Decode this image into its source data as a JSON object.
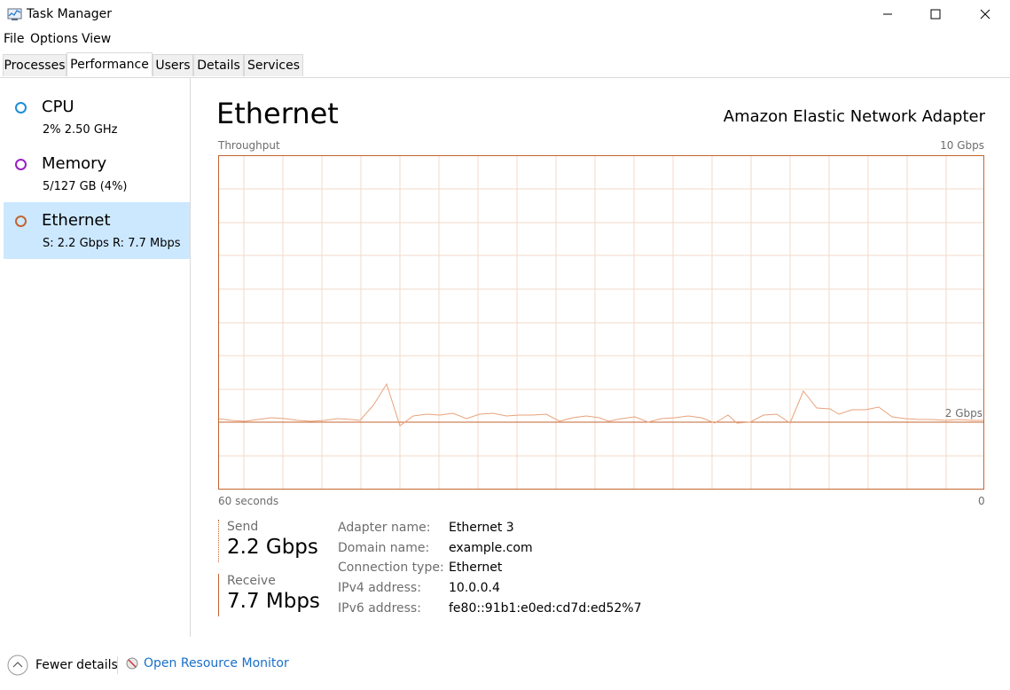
{
  "window": {
    "title": "Task Manager"
  },
  "menu": [
    "File",
    "Options",
    "View"
  ],
  "tabs": [
    "Processes",
    "Performance",
    "Users",
    "Details",
    "Services"
  ],
  "sidebar": {
    "items": [
      {
        "title": "CPU",
        "sub": "2%  2.50 GHz",
        "color": "#1f8dd6"
      },
      {
        "title": "Memory",
        "sub": "5/127 GB (4%)",
        "color": "#9b1fc1"
      },
      {
        "title": "Ethernet",
        "sub": "S: 2.2 Gbps  R: 7.7 Mbps",
        "color": "#c3652f"
      }
    ]
  },
  "main": {
    "title": "Ethernet",
    "adapter": "Amazon Elastic Network Adapter",
    "graph": {
      "label": "Throughput",
      "max_label": "10 Gbps",
      "scale_label": "2 Gbps",
      "time_label": "60 seconds",
      "zero_label": "0",
      "line_color": "#e8a27c",
      "grid_color": "#f3d9ca",
      "border_color": "#c3652f"
    },
    "send": {
      "label": "Send",
      "value": "2.2 Gbps"
    },
    "receive": {
      "label": "Receive",
      "value": "7.7 Mbps"
    },
    "properties": [
      {
        "key": "Adapter name:",
        "value": "Ethernet 3"
      },
      {
        "key": "Domain name:",
        "value": "example.com"
      },
      {
        "key": "Connection type:",
        "value": "Ethernet"
      },
      {
        "key": "IPv4 address:",
        "value": "10.0.0.4"
      },
      {
        "key": "IPv6 address:",
        "value": "fe80::91b1:e0ed:cd7d:ed52%7"
      }
    ]
  },
  "footer": {
    "fewer_details": "Fewer details",
    "resource_monitor": "Open Resource Monitor"
  }
}
